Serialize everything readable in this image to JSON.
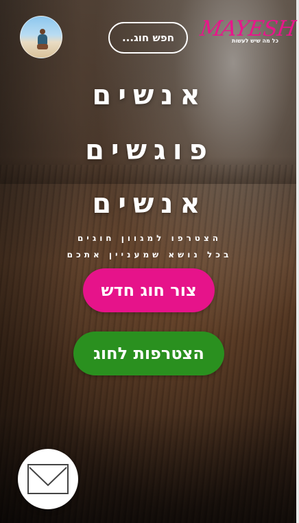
{
  "header": {
    "logo_text": "MAYESH",
    "logo_tagline": "כל מה שיש לעשות",
    "search_label": "חפש חוג...",
    "avatar_icon": "avatar-photo"
  },
  "hero": {
    "headline_line1": "אנשים",
    "headline_line2": "פוגשים",
    "headline_line3": "אנשים",
    "subtitle_line1": "הצטרפו למגוון חוגים",
    "subtitle_line2": "בכל נושא שמעניין אתכם"
  },
  "actions": {
    "create_label": "צור חוג חדש",
    "join_label": "הצטרפות לחוג",
    "mail_icon": "envelope-icon"
  },
  "colors": {
    "brand_pink": "#e6138a",
    "join_green": "#2a901f"
  }
}
